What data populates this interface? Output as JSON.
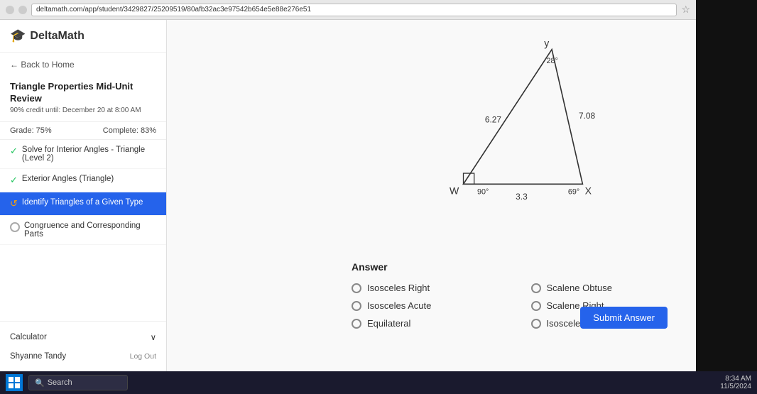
{
  "browser": {
    "url": "deltamath.com/app/student/3429827/25209519/80afb32ac3e97542b654e5e88e276e51",
    "star_label": "☆"
  },
  "logo": {
    "icon": "🎓",
    "text": "DeltaMath"
  },
  "navigation": {
    "back_label": "← Back to Home"
  },
  "assignment": {
    "title": "Triangle Properties Mid-Unit Review",
    "due": "90% credit until: December 20 at 8:00 AM",
    "grade_label": "Grade: 75%",
    "complete_label": "Complete: 83%"
  },
  "nav_items": [
    {
      "id": "solve-interior",
      "label": "Solve for Interior Angles - Triangle (Level 2)",
      "state": "completed"
    },
    {
      "id": "exterior-angles",
      "label": "Exterior Angles (Triangle)",
      "state": "completed"
    },
    {
      "id": "identify-triangles",
      "label": "Identify Triangles of a Given Type",
      "state": "active"
    },
    {
      "id": "congruence",
      "label": "Congruence and Corresponding Parts",
      "state": "default"
    }
  ],
  "sidebar_bottom": {
    "calculator_label": "Calculator",
    "expand_icon": "∨",
    "user_label": "Shyanne Tandy",
    "logout_label": "Log Out"
  },
  "triangle": {
    "vertex_y": "y",
    "vertex_w": "W",
    "vertex_x": "X",
    "angle_top": "28°",
    "angle_w": "90°",
    "angle_x": "69°",
    "side_left": "6.27",
    "side_right": "7.08",
    "side_bottom": "3.3"
  },
  "answer": {
    "section_label": "Answer",
    "options": [
      {
        "id": "isosceles-right",
        "label": "Isosceles Right"
      },
      {
        "id": "scalene-right",
        "label": "Scalene Right"
      },
      {
        "id": "scalene-obtuse",
        "label": "Scalene Obtuse"
      },
      {
        "id": "equilateral",
        "label": "Equilateral"
      },
      {
        "id": "isosceles-acute",
        "label": "Isosceles Acute"
      },
      {
        "id": "isosceles-obtuse",
        "label": "Isosceles Obtuse"
      }
    ],
    "submit_label": "Submit Answer"
  },
  "taskbar": {
    "search_placeholder": "Search",
    "time": "8:34 AM",
    "date": "11/5/2024"
  }
}
